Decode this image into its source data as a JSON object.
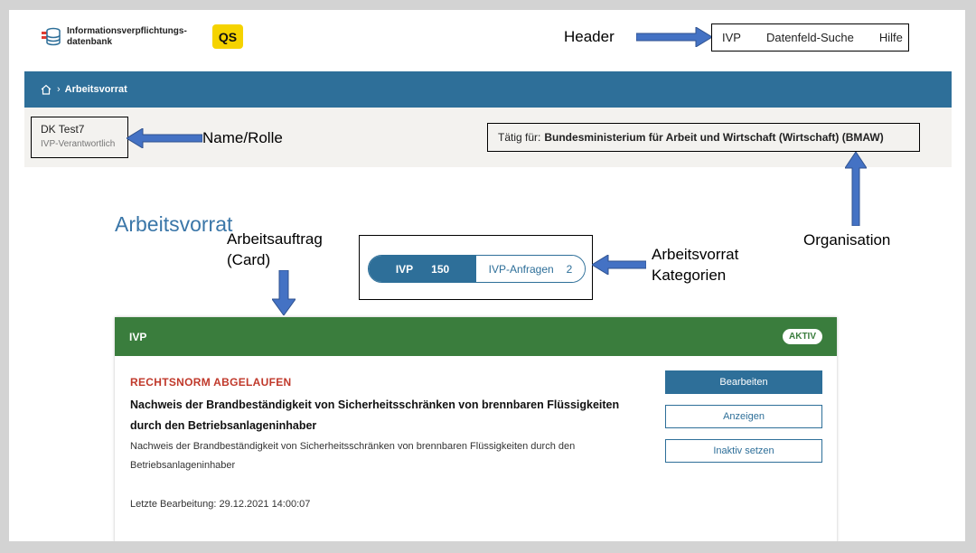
{
  "header": {
    "logo_line1": "Informationsverpflichtungs-",
    "logo_line2": "datenbank",
    "qs_badge": "QS",
    "nav": [
      "IVP",
      "Datenfeld-Suche",
      "Hilfe"
    ]
  },
  "annotations": {
    "header": "Header",
    "name_rolle": "Name/Rolle",
    "organisation": "Organisation",
    "arbeitsauftrag_line1": "Arbeitsauftrag",
    "arbeitsauftrag_line2": "(Card)",
    "kategorien_line1": "Arbeitsvorrat",
    "kategorien_line2": "Kategorien"
  },
  "breadcrumb": {
    "current": "Arbeitsvorrat"
  },
  "user": {
    "name": "DK Test7",
    "role": "IVP-Verantwortlich"
  },
  "organisation": {
    "prefix": "Tätig für:",
    "name": "Bundesministerium für Arbeit und Wirtschaft (Wirtschaft) (BMAW)"
  },
  "page_title": "Arbeitsvorrat",
  "tabs": [
    {
      "label": "IVP",
      "count": "150",
      "active": true
    },
    {
      "label": "IVP-Anfragen",
      "count": "2",
      "active": false
    }
  ],
  "card": {
    "header_title": "IVP",
    "badge": "AKTIV",
    "status": "RECHTSNORM ABGELAUFEN",
    "title": "Nachweis der Brandbeständigkeit von Sicherheitsschränken von brennbaren Flüssigkeiten durch den Betriebsanlageninhaber",
    "description": "Nachweis der Brandbeständigkeit von Sicherheitsschränken von brennbaren Flüssigkeiten durch den Betriebsanlageninhaber",
    "last_edit": "Letzte Bearbeitung: 29.12.2021 14:00:07",
    "buttons": {
      "edit": "Bearbeiten",
      "view": "Anzeigen",
      "deactivate": "Inaktiv setzen"
    }
  },
  "colors": {
    "primary": "#2e6f99",
    "card_header": "#3a7d3d",
    "status_red": "#c0392b",
    "title_blue": "#3a76a8",
    "arrow": "#4472c4"
  }
}
